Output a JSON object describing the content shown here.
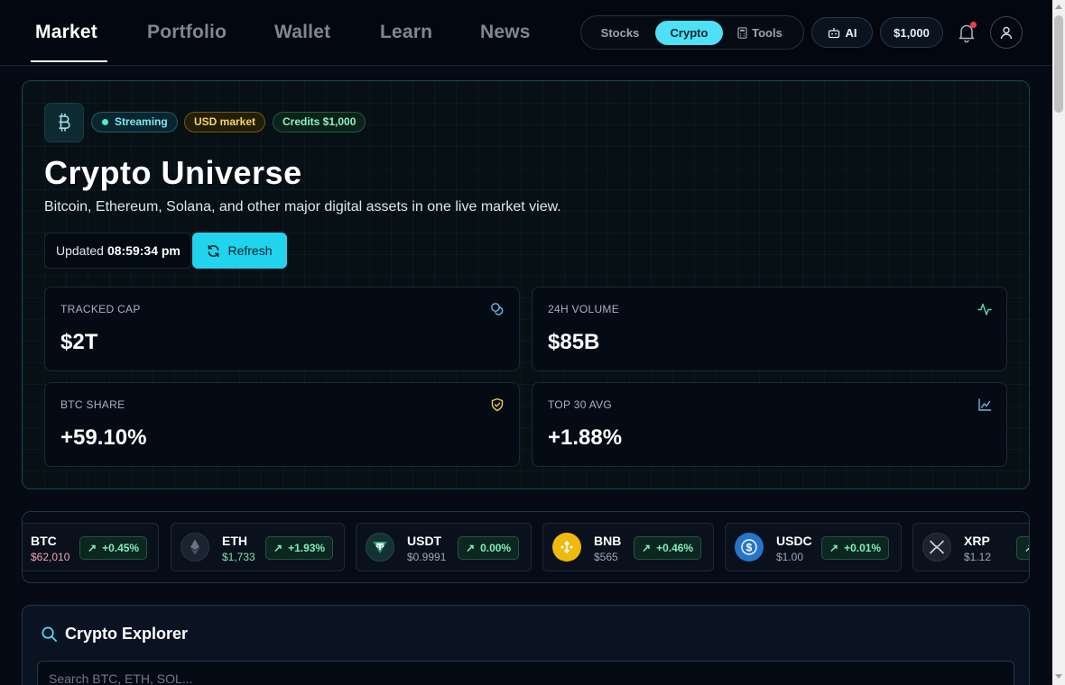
{
  "nav": {
    "tabs": [
      "Market",
      "Portfolio",
      "Wallet",
      "Learn",
      "News"
    ],
    "active_tab": "Market"
  },
  "segment": {
    "items": [
      "Stocks",
      "Crypto",
      "Tools"
    ],
    "active": "Crypto"
  },
  "header_actions": {
    "ai_label": "AI",
    "balance_label": "$1,000"
  },
  "hero": {
    "icon": "bitcoin-icon",
    "badges": {
      "streaming": "Streaming",
      "market": "USD market",
      "credits": "Credits $1,000"
    },
    "title": "Crypto Universe",
    "subtitle": "Bitcoin, Ethereum, Solana, and other major digital assets in one live market view.",
    "updated_label": "Updated",
    "updated_time": "08:59:34 pm",
    "refresh_label": "Refresh"
  },
  "stats": [
    {
      "label": "TRACKED CAP",
      "value": "$2T",
      "icon": "coins-icon"
    },
    {
      "label": "24H VOLUME",
      "value": "$85B",
      "icon": "activity-icon"
    },
    {
      "label": "BTC SHARE",
      "value": "+59.10%",
      "icon": "shield-icon"
    },
    {
      "label": "TOP 30 AVG",
      "value": "+1.88%",
      "icon": "line-chart-icon"
    }
  ],
  "ticker": [
    {
      "symbol": "BTC",
      "price": "$62,010",
      "change": "+0.45%"
    },
    {
      "symbol": "ETH",
      "price": "$1,733",
      "change": "+1.93%"
    },
    {
      "symbol": "USDT",
      "price": "$0.9991",
      "change": "0.00%"
    },
    {
      "symbol": "BNB",
      "price": "$565",
      "change": "+0.46%"
    },
    {
      "symbol": "USDC",
      "price": "$1.00",
      "change": "+0.01%"
    },
    {
      "symbol": "XRP",
      "price": "$1.12",
      "change": "+"
    }
  ],
  "colors": {
    "accent": "#22d3ee",
    "positive": "#7ff0bf",
    "btc_price": "#f0a5b0",
    "eth_price": "#7fe6a8"
  },
  "explorer": {
    "title": "Crypto Explorer",
    "search_placeholder": "Search BTC, ETH, SOL..."
  }
}
